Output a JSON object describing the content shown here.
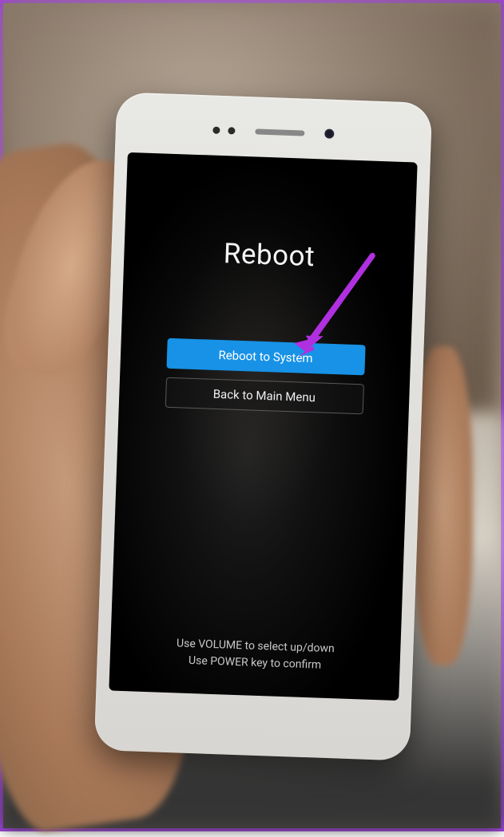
{
  "recovery_menu": {
    "title": "Reboot",
    "options": [
      {
        "label": "Reboot to System",
        "selected": true
      },
      {
        "label": "Back to Main Menu",
        "selected": false
      }
    ],
    "hint_line1": "Use VOLUME to select up/down",
    "hint_line2": "Use POWER key to confirm"
  },
  "annotation": {
    "arrow_color": "#b030e0"
  }
}
